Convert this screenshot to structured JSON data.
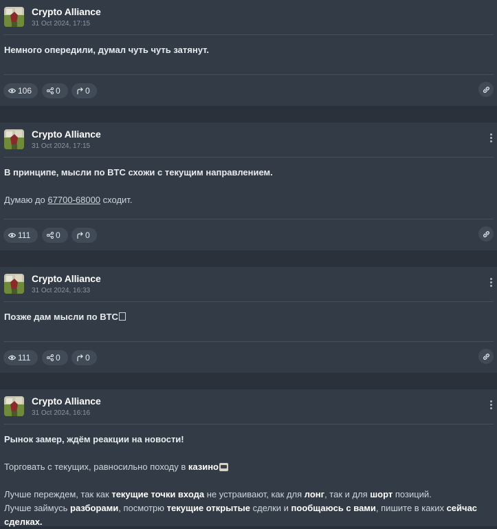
{
  "posts": [
    {
      "author": "Crypto Alliance",
      "time": "31 Oct 2024, 17:15",
      "lines": [
        "Немного опередили, думал чуть чуть затянут."
      ],
      "views": "106",
      "shares": "0",
      "forwards": "0",
      "show_menu": false
    },
    {
      "author": "Crypto Alliance",
      "time": "31 Oct 2024, 17:15",
      "line1": "В принципе, мысли по BTC схожи с текущим направлением.",
      "line2_pre": "Думаю до ",
      "line2_link": "67700-68000",
      "line2_post": " сходит.",
      "views": "111",
      "shares": "0",
      "forwards": "0",
      "show_menu": true
    },
    {
      "author": "Crypto Alliance",
      "time": "31 Oct 2024, 16:33",
      "line1": "Позже дам мысли по BTC",
      "views": "111",
      "shares": "0",
      "forwards": "0",
      "show_menu": true
    },
    {
      "author": "Crypto Alliance",
      "time": "31 Oct 2024, 16:16",
      "line1": "Рынок замер, ждём реакции на новости!",
      "line2_pre": "Торговать с текущих, равносильно походу в ",
      "line2_bold": "казино",
      "line3_pre": "Лучше переждем, так как ",
      "line3_b1": "текущие точки входа",
      "line3_mid1": " не устраивают, как для ",
      "line3_b2": "лонг",
      "line3_mid2": ", так и для ",
      "line3_b3": "шорт",
      "line3_post": " позиций.",
      "line4_pre": "Лучше займусь ",
      "line4_b1": "разборами",
      "line4_mid1": ", посмотрю ",
      "line4_b2": "текущие открытые",
      "line4_mid2": " сделки и ",
      "line4_b3": "пообщаюсь с вами",
      "line4_mid3": ", пишите в каких ",
      "line4_b4": "сейчас",
      "line5_b1": "сделках."
    }
  ],
  "icons": {
    "views": "eye-icon",
    "shares": "share-icon",
    "forwards": "forward-icon",
    "link": "link-icon",
    "menu": "more-vertical-icon"
  }
}
